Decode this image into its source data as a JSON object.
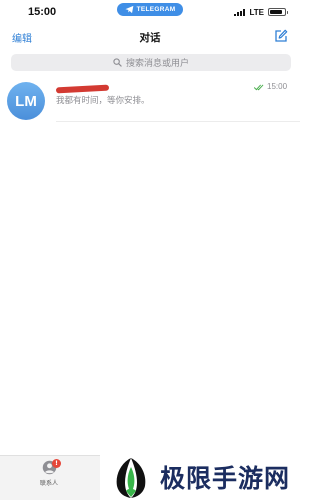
{
  "status_bar": {
    "time": "15:00",
    "app_pill": "TELEGRAM",
    "network": "LTE",
    "battery_level": 0.85
  },
  "nav": {
    "edit_label": "编辑",
    "title": "对话",
    "compose_icon": "compose-icon"
  },
  "search": {
    "placeholder": "搜索消息或用户"
  },
  "chats": [
    {
      "avatar_initials": "LM",
      "name_redacted": true,
      "preview": "我都有时间，等你安排。",
      "time": "15:00",
      "status_icon": "double-check-icon"
    }
  ],
  "tab_bar": {
    "contacts_label": "联系人",
    "contacts_badge": "!"
  },
  "watermark": {
    "text": "极限手游网"
  },
  "colors": {
    "accent": "#2f7fd5",
    "pill": "#3f8ee6",
    "avatar": "#5a9fe4",
    "redaction": "#d33a32",
    "badge": "#e5473a",
    "check": "#4caf50"
  }
}
